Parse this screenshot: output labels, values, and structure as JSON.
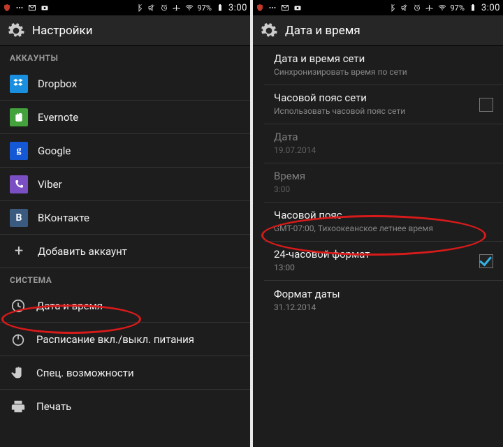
{
  "status": {
    "battery": "97%",
    "time": "3:00"
  },
  "left": {
    "title": "Настройки",
    "sections": {
      "accounts": "АККАУНТЫ",
      "system": "СИСТЕМА"
    },
    "accounts": [
      {
        "label": "Dropbox"
      },
      {
        "label": "Evernote"
      },
      {
        "label": "Google"
      },
      {
        "label": "Viber"
      },
      {
        "label": "ВКонтакте"
      }
    ],
    "add_account": "Добавить аккаунт",
    "system_items": {
      "datetime": "Дата и время",
      "schedule": "Расписание вкл./выкл. питания",
      "accessibility": "Спец. возможности",
      "printing": "Печать"
    }
  },
  "right": {
    "title": "Дата и время",
    "rows": {
      "net_time": {
        "primary": "Дата и время сети",
        "secondary": "Синхронизировать время по сети"
      },
      "net_tz": {
        "primary": "Часовой пояс сети",
        "secondary": "Использовать часовой пояс сети"
      },
      "date": {
        "primary": "Дата",
        "secondary": "19.07.2014"
      },
      "time": {
        "primary": "Время",
        "secondary": "3:00"
      },
      "tz": {
        "primary": "Часовой пояс",
        "secondary": "GMT-07:00, Тихоокеанское летнее время"
      },
      "hour24": {
        "primary": "24-часовой формат",
        "secondary": "13:00"
      },
      "datefmt": {
        "primary": "Формат даты",
        "secondary": "31.12.2014"
      }
    }
  }
}
